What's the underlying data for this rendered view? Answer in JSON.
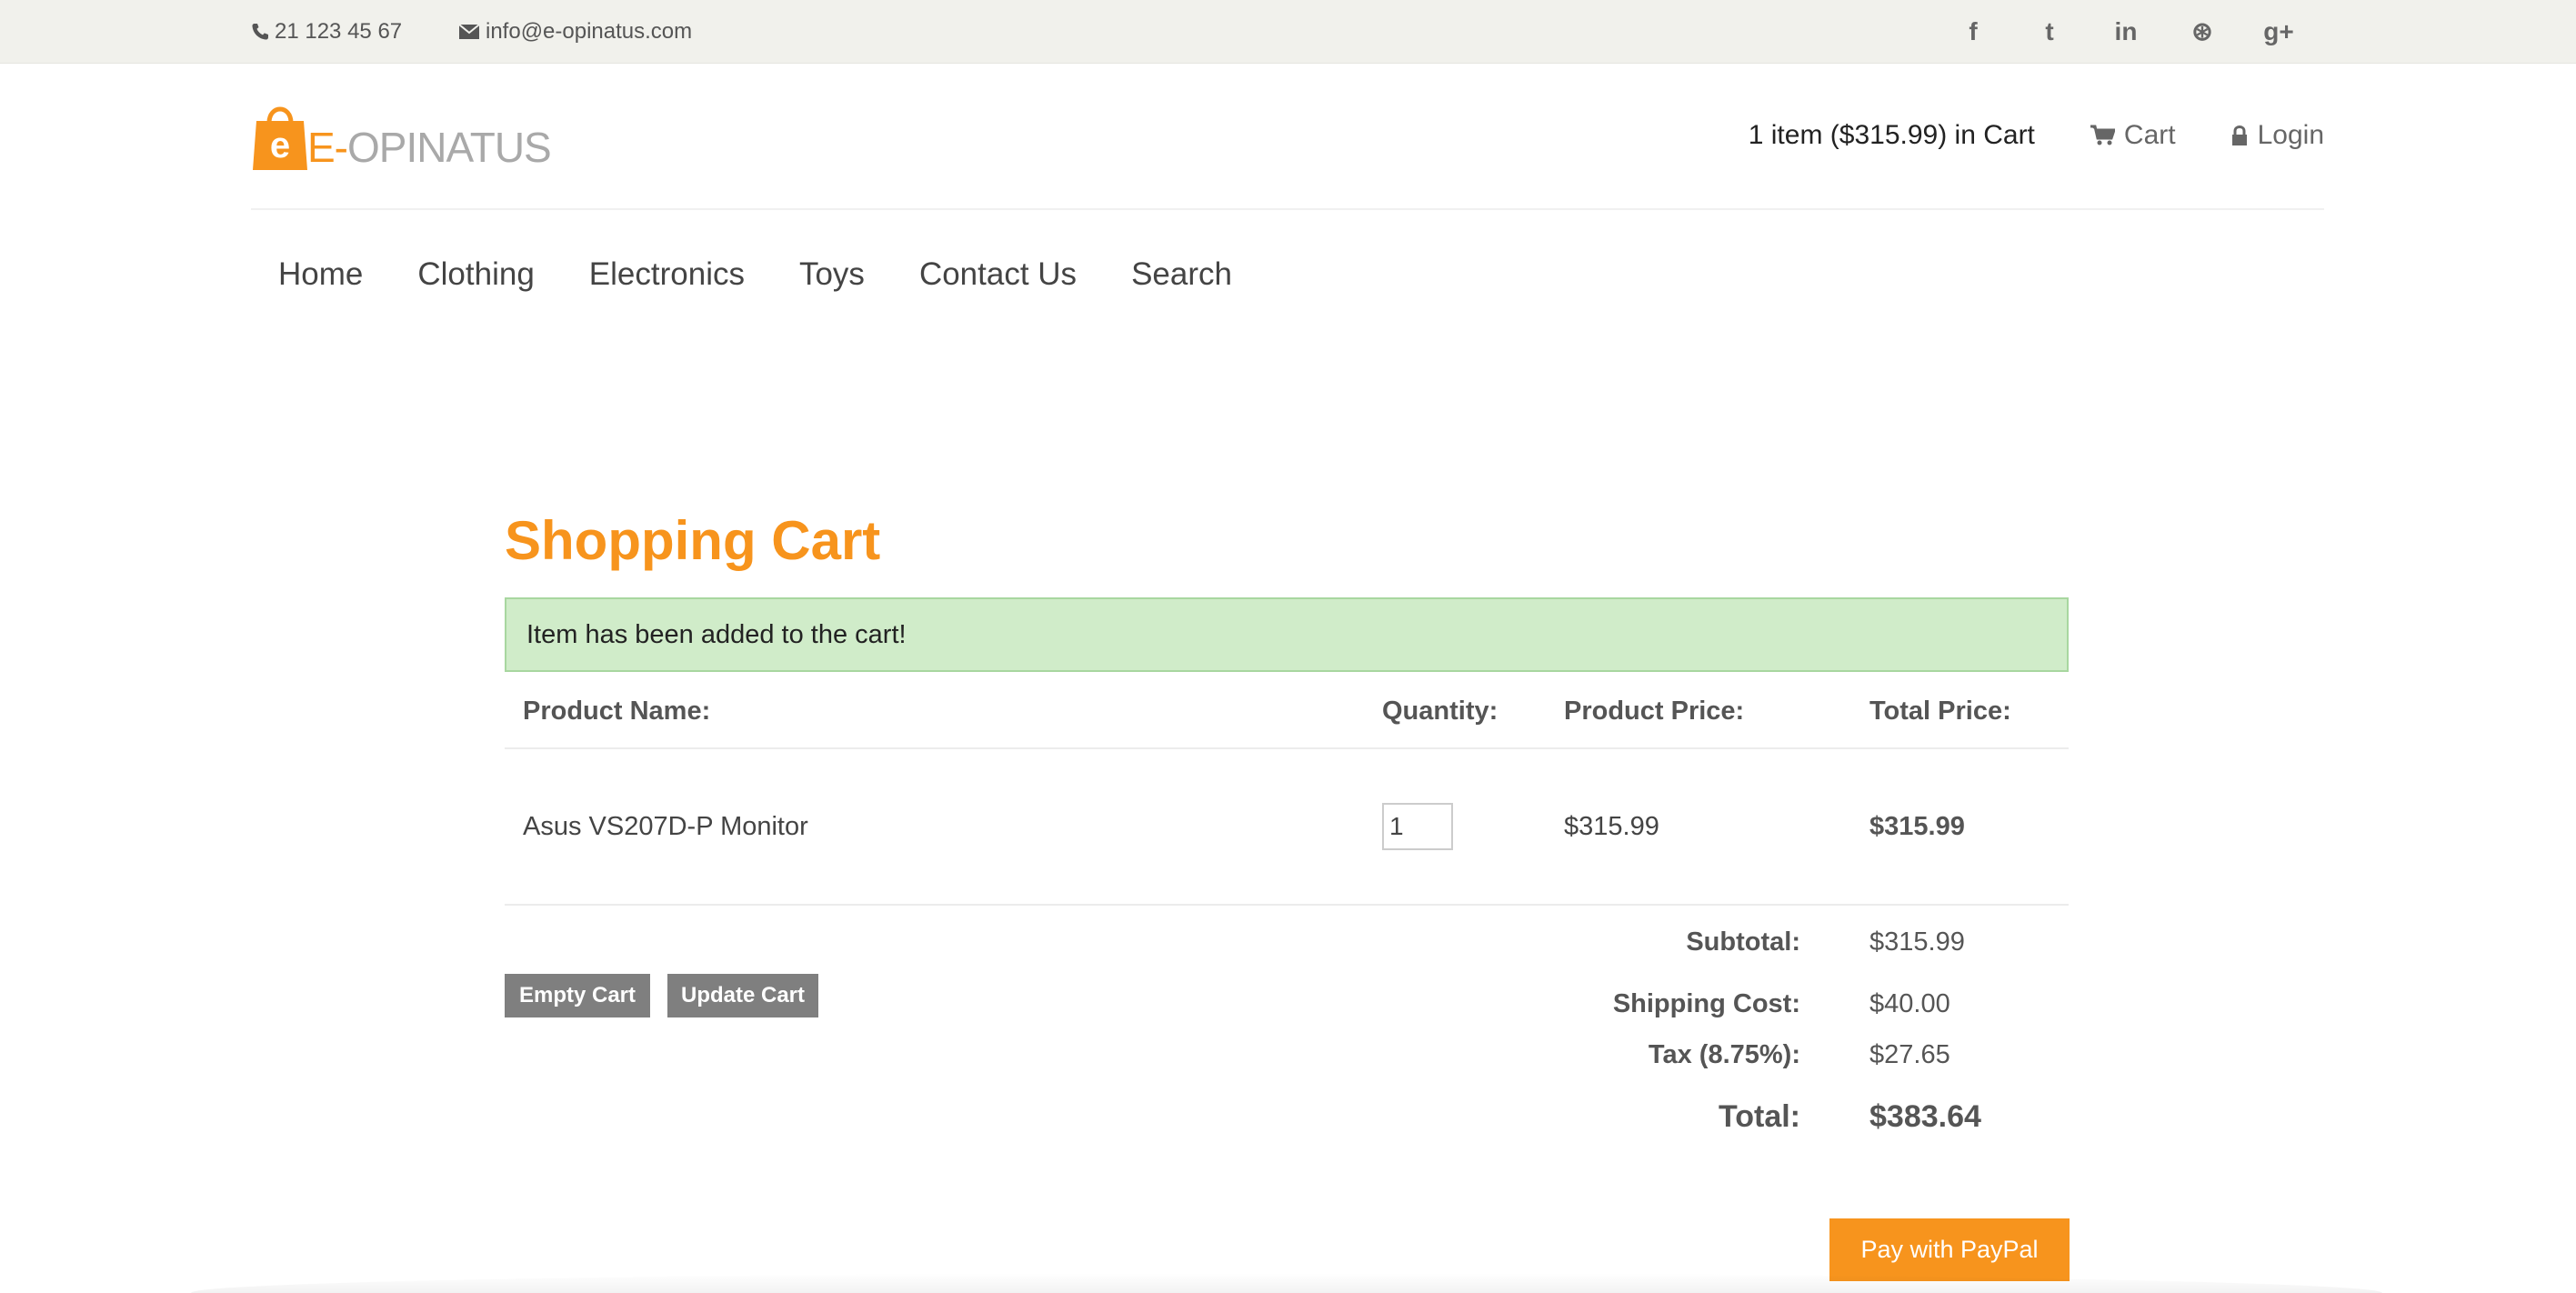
{
  "topbar": {
    "phone": "21 123 45 67",
    "email": "info@e-opinatus.com",
    "social": [
      {
        "icon": "facebook-icon",
        "glyph": "f"
      },
      {
        "icon": "twitter-icon",
        "glyph": "t"
      },
      {
        "icon": "linkedin-icon",
        "glyph": "in"
      },
      {
        "icon": "dribbble-icon",
        "glyph": "⊛"
      },
      {
        "icon": "google-plus-icon",
        "glyph": "g+"
      }
    ]
  },
  "header": {
    "logo_badge": "e",
    "logo_prefix": "E-",
    "logo_text": "OPINATUS",
    "cart_summary": "1 item ($315.99) in Cart",
    "cart_link": "Cart",
    "login_link": "Login"
  },
  "nav": [
    "Home",
    "Clothing",
    "Electronics",
    "Toys",
    "Contact Us",
    "Search"
  ],
  "cart": {
    "title": "Shopping Cart",
    "alert": "Item has been added to the cart!",
    "columns": {
      "name": "Product Name:",
      "quantity": "Quantity:",
      "price": "Product Price:",
      "total": "Total Price:"
    },
    "items": [
      {
        "name": "Asus VS207D-P Monitor",
        "quantity": "1",
        "price": "$315.99",
        "total": "$315.99"
      }
    ],
    "buttons": {
      "empty": "Empty Cart",
      "update": "Update Cart",
      "pay": "Pay with PayPal"
    },
    "summary": {
      "subtotal_label": "Subtotal:",
      "subtotal": "$315.99",
      "shipping_label": "Shipping Cost:",
      "shipping": "$40.00",
      "tax_label": "Tax (8.75%):",
      "tax": "$27.65",
      "total_label": "Total:",
      "total": "$383.64"
    }
  },
  "colors": {
    "accent": "#f7941d",
    "alert_bg": "#d0ecc9",
    "button_grey": "#7f7f7f",
    "topbar_bg": "#f1f1ec"
  }
}
